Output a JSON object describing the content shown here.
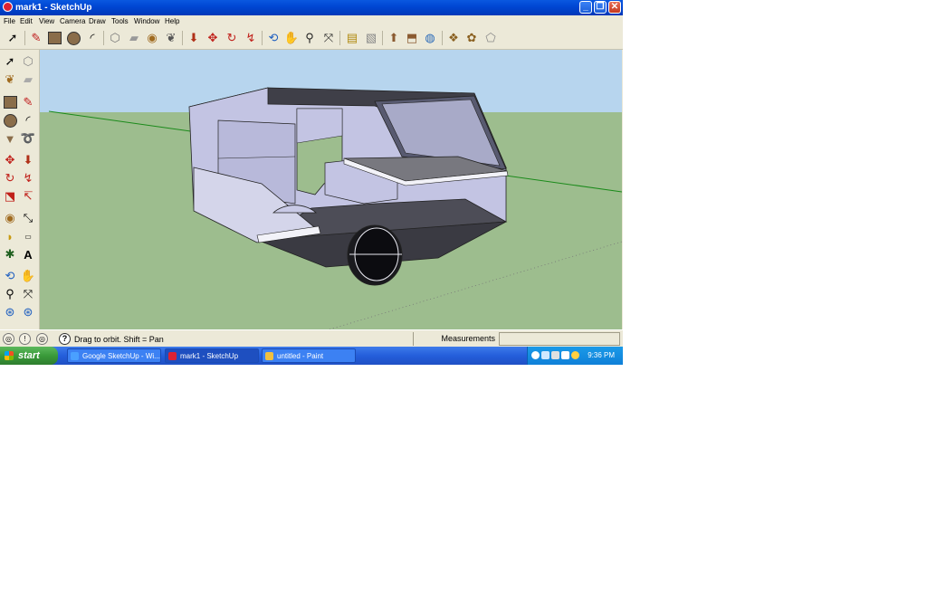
{
  "window": {
    "title": "mark1 - SketchUp"
  },
  "caption_buttons": {
    "minimize": "_",
    "restore": "❐",
    "close": "✕"
  },
  "menu": [
    "File",
    "Edit",
    "View",
    "Camera",
    "Draw",
    "Tools",
    "Window",
    "Help"
  ],
  "toolbar_icons": [
    "select-icon",
    "pencil-icon",
    "rectangle-icon",
    "circle-icon",
    "arc-icon",
    "make-component-icon",
    "eraser-icon",
    "tape-measure-icon",
    "paint-bucket-icon",
    "push-pull-icon",
    "move-icon",
    "rotate-icon",
    "follow-me-icon",
    "orbit-icon",
    "pan-icon",
    "zoom-icon",
    "zoom-extents-icon",
    "get-models-icon",
    "share-model-icon",
    "place-model-icon",
    "get-photo-texture-icon",
    "google-earth-icon",
    "components-icon",
    "materials-icon",
    "styles-icon"
  ],
  "left_toolbar_icons": [
    "select-icon",
    "make-component-icon",
    "paint-bucket-icon",
    "eraser-icon",
    "rectangle-icon",
    "line-icon",
    "circle-icon",
    "arc-icon",
    "polygon-icon",
    "freehand-icon",
    "move-icon",
    "push-pull-icon",
    "rotate-icon",
    "follow-me-icon",
    "scale-icon",
    "offset-icon",
    "tape-measure-icon",
    "dimension-icon",
    "protractor-icon",
    "text-icon",
    "axes-icon",
    "3d-text-icon",
    "orbit-icon",
    "pan-icon",
    "zoom-icon",
    "zoom-window-icon",
    "previous-view-icon",
    "next-view-icon"
  ],
  "status": {
    "hint": "Drag to orbit.  Shift = Pan",
    "measurements_label": "Measurements",
    "measurements_value": ""
  },
  "taskbar": {
    "start": "start",
    "tasks": [
      {
        "label": "Google SketchUp - Wi...",
        "active": false
      },
      {
        "label": "mark1 - SketchUp",
        "active": true
      },
      {
        "label": "untitled - Paint",
        "active": false
      }
    ],
    "clock": "9:36 PM"
  },
  "colors": {
    "sky": "#b7d5ee",
    "ground": "#9dbd8e",
    "model_face": "#c3c4e3",
    "model_dark": "#4b4b55",
    "titlebar": "#0047d4"
  }
}
